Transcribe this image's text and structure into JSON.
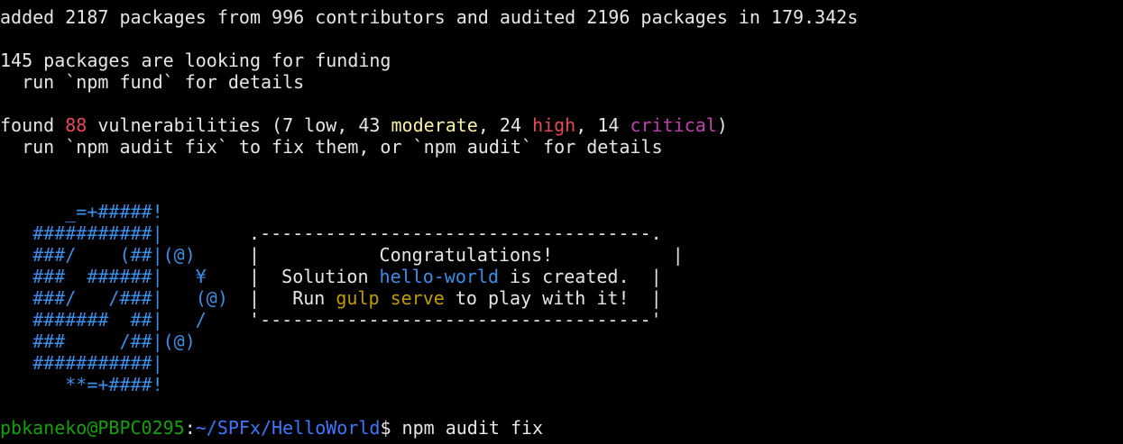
{
  "npm_output": {
    "added_line": "added 2187 packages from 996 contributors and audited 2196 packages in 179.342s",
    "funding_line": "145 packages are looking for funding",
    "fund_hint": "  run `npm fund` for details",
    "found_prefix": "found ",
    "vuln_count": "88",
    "vuln_mid": " vulnerabilities (7 ",
    "low_label": "low",
    "sep1": ", 43 ",
    "moderate_label": "moderate",
    "sep2": ", 24 ",
    "high_label": "high",
    "sep3": ", 14 ",
    "critical_label": "critical",
    "close_paren": ")",
    "audit_hint": "  run `npm audit fix` to fix them, or `npm audit` for details"
  },
  "banner": {
    "art": [
      "      _=+#####!",
      "   ###########|",
      "   ###/    (##|(@)",
      "   ###  ######|   ¥",
      "   ###/   /###|   (@)",
      "   #######  ##|   /",
      "   ###     /##|(@)",
      "   ###########|",
      "      **=+####!"
    ],
    "box_top": " .------------------------------------.",
    "box_line1_pre": " |           ",
    "box_congrats": "Congratulations!",
    "box_line1_post": "           |",
    "box_line2_pre": " |  Solution ",
    "box_solution_name": "hello-world",
    "box_line2_post": " is created.  |",
    "box_line3_pre": " |   Run ",
    "box_command": "gulp serve",
    "box_line3_post": " to play with it!  |",
    "box_bottom": " '------------------------------------'"
  },
  "prompt": {
    "user_host": "pbkaneko@PBPC0295",
    "colon": ":",
    "path": "~/SPFx/HelloWorld",
    "dollar": "$ ",
    "command": "npm audit fix"
  },
  "colors": {
    "background": "#000000",
    "foreground": "#e6e6e6",
    "count_red": "#e74856",
    "low_white": "#e6e6e6",
    "moderate_yellow": "#f9f1a5",
    "high_red": "#e74856",
    "critical_magenta": "#c23fb2",
    "art_blue": "#3b8eea",
    "command_gold": "#c19c00",
    "prompt_green": "#13a10e",
    "path_blue": "#3b78ff"
  }
}
